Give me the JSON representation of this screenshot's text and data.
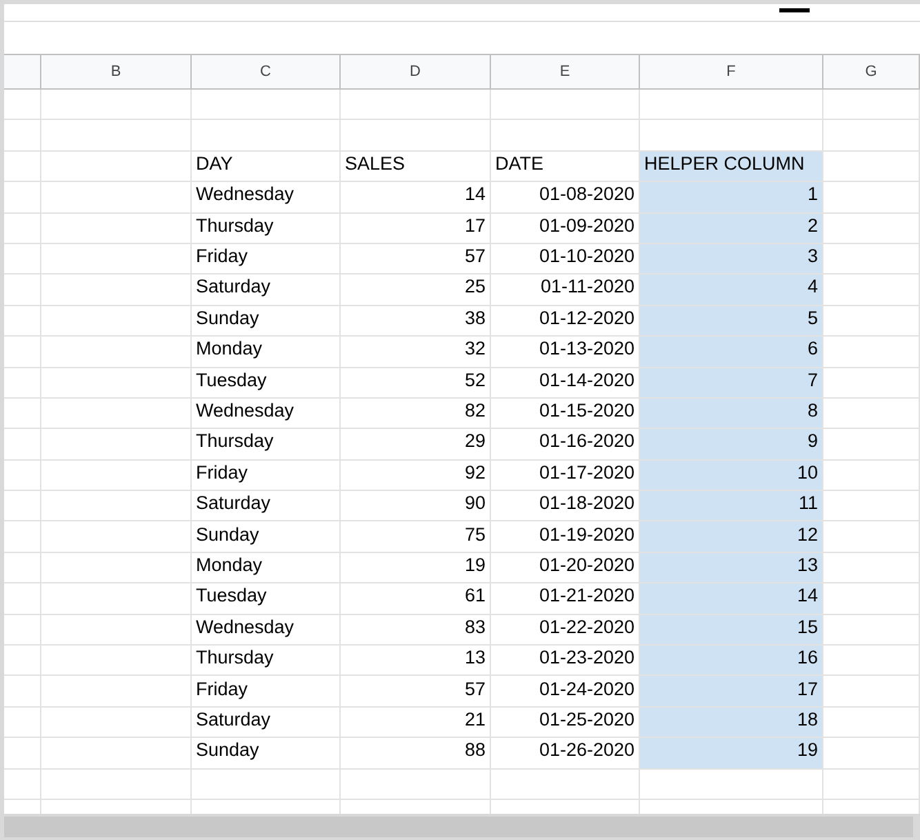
{
  "columns": [
    {
      "label": "B",
      "selected": false
    },
    {
      "label": "C",
      "selected": false
    },
    {
      "label": "D",
      "selected": false
    },
    {
      "label": "E",
      "selected": false
    },
    {
      "label": "F",
      "selected": true
    },
    {
      "label": "G",
      "selected": false
    }
  ],
  "table": {
    "headings": [
      "DAY",
      "SALES",
      "DATE",
      "HELPER COLUMN"
    ],
    "rows": [
      {
        "day": "Wednesday",
        "sales": "14",
        "date": "01-08-2020",
        "helper": "1"
      },
      {
        "day": "Thursday",
        "sales": "17",
        "date": "01-09-2020",
        "helper": "2"
      },
      {
        "day": "Friday",
        "sales": "57",
        "date": "01-10-2020",
        "helper": "3"
      },
      {
        "day": "Saturday",
        "sales": "25",
        "date": "01-11-2020",
        "helper": "4"
      },
      {
        "day": "Sunday",
        "sales": "38",
        "date": "01-12-2020",
        "helper": "5"
      },
      {
        "day": "Monday",
        "sales": "32",
        "date": "01-13-2020",
        "helper": "6"
      },
      {
        "day": "Tuesday",
        "sales": "52",
        "date": "01-14-2020",
        "helper": "7"
      },
      {
        "day": "Wednesday",
        "sales": "82",
        "date": "01-15-2020",
        "helper": "8"
      },
      {
        "day": "Thursday",
        "sales": "29",
        "date": "01-16-2020",
        "helper": "9"
      },
      {
        "day": "Friday",
        "sales": "92",
        "date": "01-17-2020",
        "helper": "10"
      },
      {
        "day": "Saturday",
        "sales": "90",
        "date": "01-18-2020",
        "helper": "11"
      },
      {
        "day": "Sunday",
        "sales": "75",
        "date": "01-19-2020",
        "helper": "12"
      },
      {
        "day": "Monday",
        "sales": "19",
        "date": "01-20-2020",
        "helper": "13"
      },
      {
        "day": "Tuesday",
        "sales": "61",
        "date": "01-21-2020",
        "helper": "14"
      },
      {
        "day": "Wednesday",
        "sales": "83",
        "date": "01-22-2020",
        "helper": "15"
      },
      {
        "day": "Thursday",
        "sales": "13",
        "date": "01-23-2020",
        "helper": "16"
      },
      {
        "day": "Friday",
        "sales": "57",
        "date": "01-24-2020",
        "helper": "17"
      },
      {
        "day": "Saturday",
        "sales": "21",
        "date": "01-25-2020",
        "helper": "18"
      },
      {
        "day": "Sunday",
        "sales": "88",
        "date": "01-26-2020",
        "helper": "19"
      }
    ]
  }
}
